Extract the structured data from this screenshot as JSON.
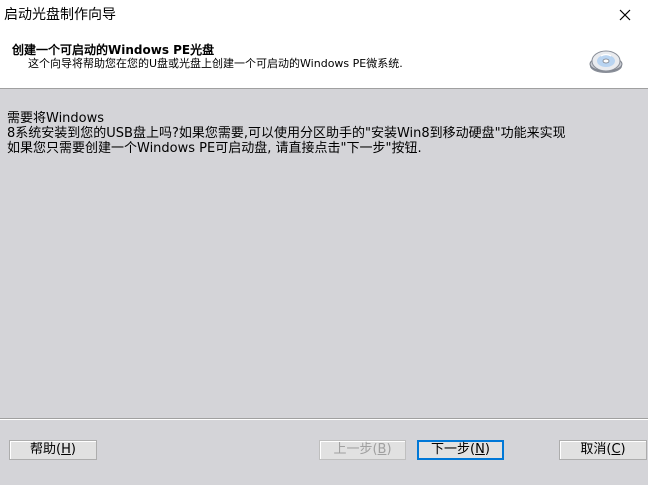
{
  "window": {
    "title": "启动光盘制作向导",
    "close_glyph": "✕"
  },
  "header": {
    "title": "创建一个可启动的Windows PE光盘",
    "subtitle": "这个向导将帮助您在您的U盘或光盘上创建一个可启动的Windows PE微系统.",
    "icon": "disc-install-icon"
  },
  "body": {
    "message": "需要将Windows\n8系统安装到您的USB盘上吗?如果您需要,可以使用分区助手的\"安装Win8到移动硬盘\"功能来实现\n如果您只需要创建一个Windows PE可启动盘, 请直接点击\"下一步\"按钮."
  },
  "buttons": {
    "help": {
      "label": "帮助(",
      "key": "H",
      "tail": ")"
    },
    "prev": {
      "label": "上一步(",
      "key": "B",
      "tail": ")",
      "enabled": false
    },
    "next": {
      "label": "下一步(",
      "key": "N",
      "tail": ")",
      "default": true
    },
    "cancel": {
      "label": "取消(",
      "key": "C",
      "tail": ")"
    }
  },
  "colors": {
    "background": "#d4d4d8",
    "header_bg": "#ffffff",
    "default_button_border": "#0078d7"
  }
}
